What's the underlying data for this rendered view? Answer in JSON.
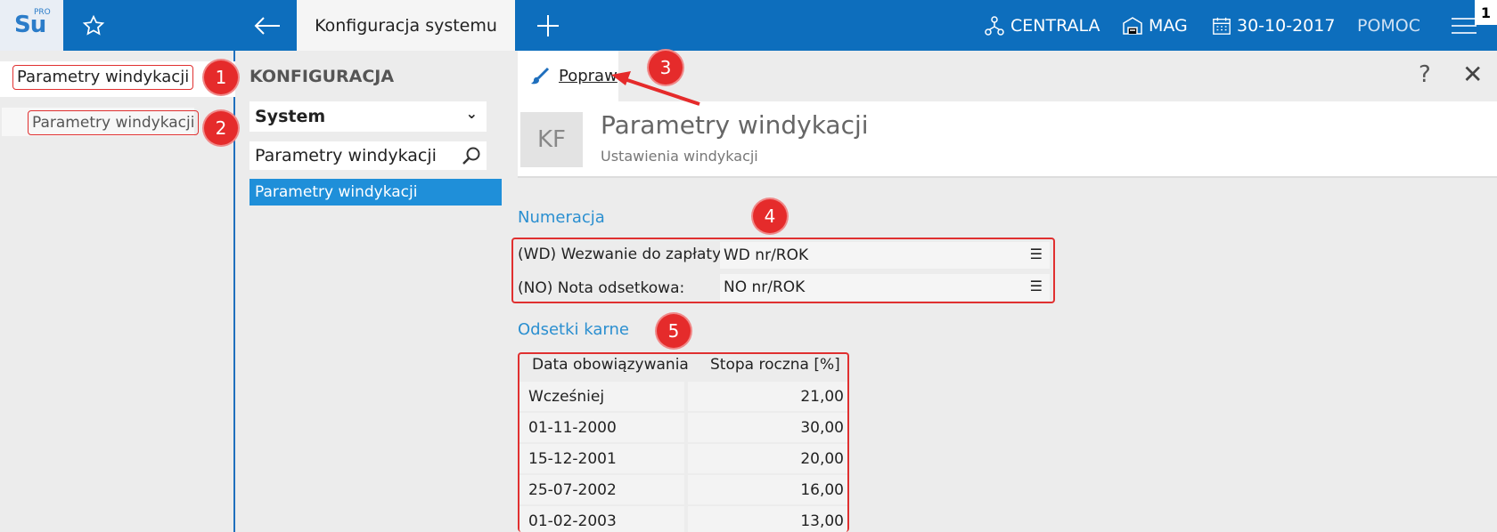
{
  "topbar": {
    "logo_text": "Su",
    "logo_sup": "PRO",
    "active_tab": "Konfiguracja systemu",
    "centrala": "CENTRALA",
    "mag": "MAG",
    "date": "30-10-2017",
    "help": "POMOC",
    "badge": "1"
  },
  "left": {
    "search_value": "Parametry windykacji",
    "result": "Parametry windykacji"
  },
  "mid": {
    "title": "KONFIGURACJA",
    "select_value": "System",
    "search_value": "Parametry windykacji",
    "item": "Parametry windykacji"
  },
  "toolbar": {
    "edit_label": "Popraw",
    "help": "?",
    "close": "✕"
  },
  "header": {
    "avatar": "KF",
    "title": "Parametry windykacji",
    "subtitle": "Ustawienia windykacji"
  },
  "numeracja": {
    "title": "Numeracja",
    "rows": [
      {
        "label": "(WD) Wezwanie do zapłaty:",
        "value": "WD nr/ROK"
      },
      {
        "label": "(NO) Nota odsetkowa:",
        "value": "NO nr/ROK"
      }
    ]
  },
  "odsetki": {
    "title": "Odsetki karne",
    "columns": [
      "Data obowiązywania",
      "Stopa roczna [%]"
    ],
    "rows": [
      [
        "Wcześniej",
        "21,00"
      ],
      [
        "01-11-2000",
        "30,00"
      ],
      [
        "15-12-2001",
        "20,00"
      ],
      [
        "25-07-2002",
        "16,00"
      ],
      [
        "01-02-2003",
        "13,00"
      ]
    ]
  },
  "markers": [
    "1",
    "2",
    "3",
    "4",
    "5"
  ],
  "colors": {
    "topbar": "#0d6ebd",
    "accent": "#2b8fd0",
    "selected": "#1f8fd9",
    "annotation": "#e52b2b"
  }
}
